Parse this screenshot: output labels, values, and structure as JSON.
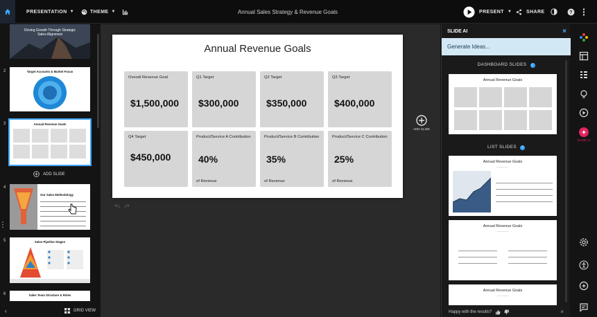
{
  "topbar": {
    "presentation_label": "PRESENTATION",
    "theme_label": "THEME",
    "doc_title": "Annual Sales Strategy & Revenue Goals",
    "present_label": "PRESENT",
    "share_label": "SHARE"
  },
  "left_panel": {
    "slides": [
      {
        "number": "",
        "title": "Driving Growth Through Strategic Sales Alignment"
      },
      {
        "number": "2",
        "title": "Target Accounts & Market Focus"
      },
      {
        "number": "3",
        "title": "Annual Revenue Goals"
      },
      {
        "number": "4",
        "title": "Our Sales Methodology"
      },
      {
        "number": "5",
        "title": "Sales Pipeline Stages"
      },
      {
        "number": "6",
        "title": "Sales Team Structure & Roles"
      }
    ],
    "add_slide_label": "ADD SLIDE",
    "grid_view_label": "GRID VIEW"
  },
  "slide": {
    "title": "Annual Revenue Goals",
    "cards": [
      {
        "label": "Overall Revenue Goal",
        "value": "$1,500,000",
        "sub": ""
      },
      {
        "label": "Q1 Target",
        "value": "$300,000",
        "sub": ""
      },
      {
        "label": "Q2 Target",
        "value": "$350,000",
        "sub": ""
      },
      {
        "label": "Q3 Target",
        "value": "$400,000",
        "sub": ""
      },
      {
        "label": "Q4 Target",
        "value": "$450,000",
        "sub": ""
      },
      {
        "label": "Product/Service A Contribution",
        "value": "40%",
        "sub": "of Revenue"
      },
      {
        "label": "Product/Service B Contribution",
        "value": "35%",
        "sub": "of Revenue"
      },
      {
        "label": "Product/Service C Contribution",
        "value": "25%",
        "sub": "of Revenue"
      }
    ]
  },
  "editor": {
    "add_slide_label": "ADD SLIDE"
  },
  "ai_panel": {
    "title": "SLIDE AI",
    "generate_label": "Generate Ideas...",
    "dashboard_label": "DASHBOARD SLIDES",
    "list_label": "LIST SLIDES",
    "card_title": "Annual Revenue Goals",
    "feedback_label": "Happy with the results?"
  },
  "right_bar": {
    "slide_ai_label": "SLIDE AI"
  },
  "colors": {
    "accent": "#3da5ff",
    "ai_highlight": "#d3e8f5",
    "ai_badge": "#e0245e"
  }
}
